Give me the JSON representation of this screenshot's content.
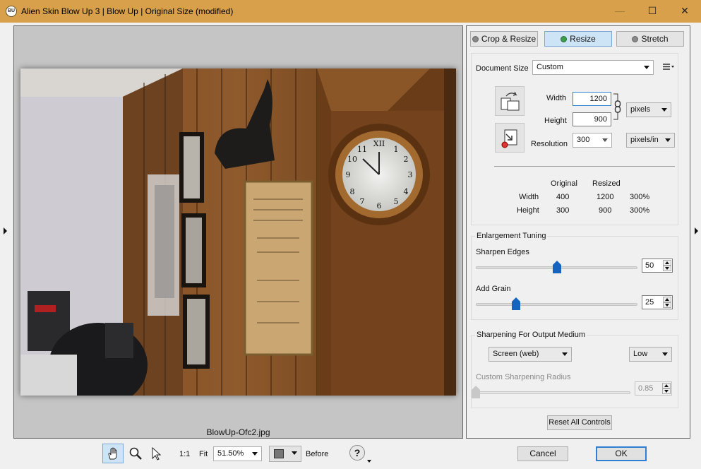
{
  "window": {
    "title": "Alien Skin Blow Up 3 | Blow Up | Original Size (modified)",
    "app_icon_text": "BU",
    "minimize_glyph": "—",
    "maximize_glyph": "☐",
    "close_glyph": "✕"
  },
  "preview": {
    "filename": "BlowUp-Ofc2.jpg"
  },
  "bottombar": {
    "tools": [
      "hand-tool-icon",
      "zoom-tool-icon",
      "select-tool-icon"
    ],
    "one_to_one": "1:1",
    "fit": "Fit",
    "zoom_value": "51.50%",
    "before": "Before",
    "help_glyph": "?",
    "cancel": "Cancel",
    "ok": "OK"
  },
  "tabs": [
    {
      "label": "Crop & Resize",
      "selected": false
    },
    {
      "label": "Resize",
      "selected": true
    },
    {
      "label": "Stretch",
      "selected": false
    }
  ],
  "resize": {
    "doc_size_label": "Document Size",
    "doc_size_value": "Custom",
    "width_label": "Width",
    "width_value": "1200",
    "height_label": "Height",
    "height_value": "900",
    "unit_value": "pixels",
    "resolution_label": "Resolution",
    "resolution_value": "300",
    "res_unit_value": "pixels/in",
    "table": {
      "head_original": "Original",
      "head_resized": "Resized",
      "rows": [
        {
          "label": "Width",
          "original": "400",
          "resized": "1200",
          "percent": "300%"
        },
        {
          "label": "Height",
          "original": "300",
          "resized": "900",
          "percent": "300%"
        }
      ]
    }
  },
  "tuning": {
    "title": "Enlargement Tuning",
    "sharpen_label": "Sharpen Edges",
    "sharpen_value": "50",
    "sharpen_level": 0.5,
    "grain_label": "Add Grain",
    "grain_value": "25",
    "grain_level": 0.25
  },
  "output": {
    "title": "Sharpening For Output Medium",
    "medium_value": "Screen (web)",
    "strength_value": "Low",
    "radius_label": "Custom Sharpening Radius",
    "radius_value": "0.85",
    "radius_level": 0.0
  },
  "reset_label": "Reset All Controls",
  "colors": {
    "titlebar": "#d8a04a",
    "accent": "#2f7fd5",
    "slider_thumb": "#1565c0"
  }
}
